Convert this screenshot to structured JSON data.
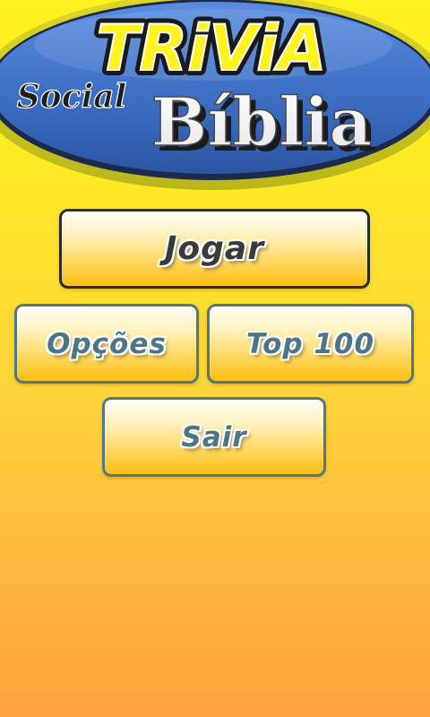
{
  "logo": {
    "title": "TRiViA",
    "social": "Social",
    "biblia": "Bíblia"
  },
  "menu": {
    "play_label": "Jogar",
    "options_label": "Opções",
    "top_label": "Top 100",
    "exit_label": "Sair"
  },
  "colors": {
    "background_top": "#fff21f",
    "background_bottom": "#ffa23c",
    "logo_blue": "#3d6fc4",
    "logo_rim": "#c9c71d",
    "title_yellow": "#fff21f",
    "button_border_main": "#2b2b2b",
    "button_border_secondary": "#4f7a84",
    "button_text_main": "#3a3a3a",
    "button_text_secondary": "#4d7684"
  }
}
